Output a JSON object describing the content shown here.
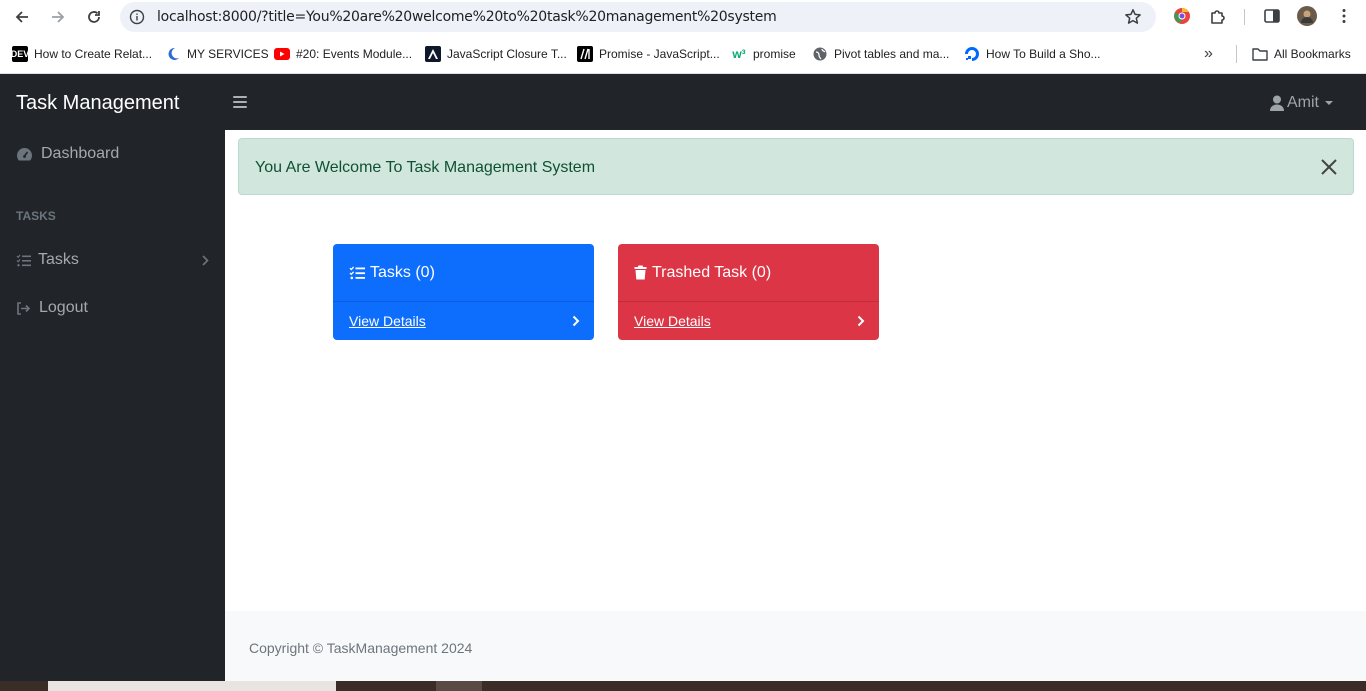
{
  "browser": {
    "url": "localhost:8000/?title=You%20are%20welcome%20to%20task%20management%20system",
    "bookmarks": [
      {
        "label": "How to Create Relat...",
        "icon": "dev-icon"
      },
      {
        "label": "MY SERVICES",
        "icon": "moon-icon"
      },
      {
        "label": "#20: Events Module...",
        "icon": "youtube-icon"
      },
      {
        "label": "JavaScript Closure T...",
        "icon": "a-icon"
      },
      {
        "label": "Promise - JavaScript...",
        "icon": "mdn-icon"
      },
      {
        "label": "promise",
        "icon": "w3-icon"
      },
      {
        "label": "Pivot tables and ma...",
        "icon": "globe-icon"
      },
      {
        "label": "How To Build a Sho...",
        "icon": "do-icon"
      }
    ],
    "more_label": "»",
    "all_bookmarks_label": "All Bookmarks"
  },
  "app": {
    "brand": "Task Management",
    "user_name": "Amit"
  },
  "sidebar": {
    "dashboard_label": "Dashboard",
    "section_heading": "TASKS",
    "tasks_label": "Tasks",
    "logout_label": "Logout"
  },
  "alert": {
    "message": "You Are Welcome To Task Management System"
  },
  "cards": [
    {
      "title": "Tasks (0)",
      "link_label": "View Details",
      "color": "#0d6efd"
    },
    {
      "title": "Trashed Task (0)",
      "link_label": "View Details",
      "color": "#dc3545"
    }
  ],
  "footer": {
    "text": "Copyright © TaskManagement 2024"
  },
  "colors": {
    "dark": "#212529",
    "primary": "#0d6efd",
    "danger": "#dc3545",
    "success_bg": "#d1e7dd"
  }
}
